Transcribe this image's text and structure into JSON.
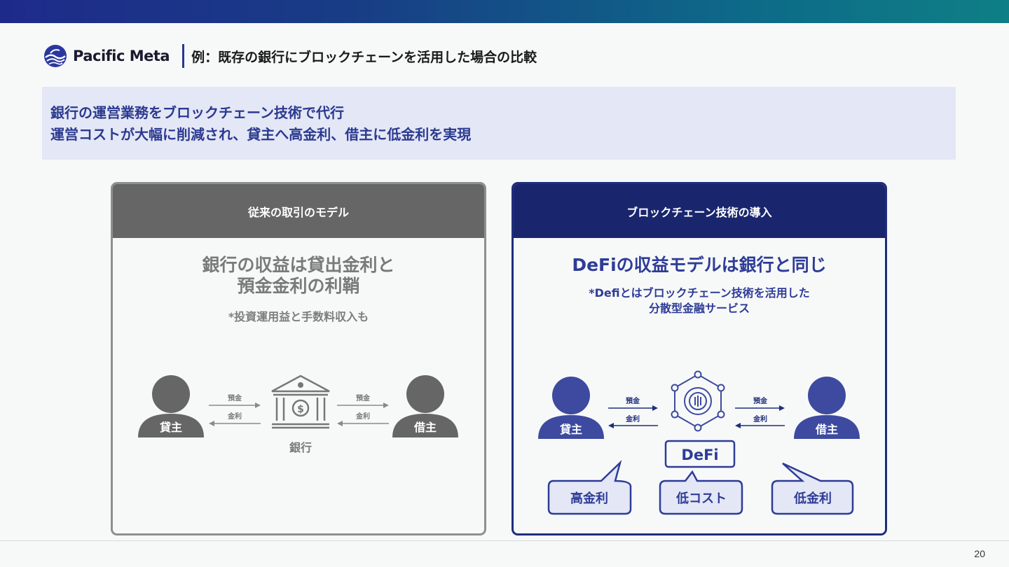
{
  "brand": {
    "name": "Pacific Meta"
  },
  "page_title": "例：既存の銀行にブロックチェーンを活用した場合の比較",
  "banner": {
    "line1": "銀行の運営業務をブロックチェーン技術で代行",
    "line2": "運営コストが大幅に削減され、貸主へ高金利、借主に低金利を実現"
  },
  "left_panel": {
    "header": "従来の取引のモデル",
    "headline_1": "銀行の収益は貸出金利と",
    "headline_2": "預金金利の利鞘",
    "sub": "*投資運用益と手数料収入も",
    "lender": "貸主",
    "borrower": "借主",
    "bank": "銀行",
    "arrow_deposit": "預金",
    "arrow_interest": "金利"
  },
  "right_panel": {
    "header": "ブロックチェーン技術の導入",
    "headline": "DeFiの収益モデルは銀行と同じ",
    "sub_1": "*Defiとはブロックチェーン技術を活用した",
    "sub_2": "分散型金融サービス",
    "lender": "貸主",
    "borrower": "借主",
    "defi": "DeFi",
    "arrow_deposit": "預金",
    "arrow_interest": "金利",
    "bubble_high": "高金利",
    "bubble_cost": "低コスト",
    "bubble_low": "低金利"
  },
  "page_number": "20",
  "colors": {
    "accent": "#2e3c96",
    "navy": "#19266d",
    "gray": "#666666",
    "banner_bg": "#e4e7f6"
  }
}
